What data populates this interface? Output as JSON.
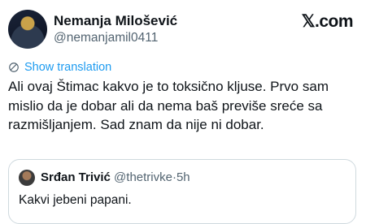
{
  "author": {
    "name": "Nemanja Milošević",
    "handle": "@nemanjamil0411"
  },
  "brand": "𝕏.com",
  "translate": {
    "label": "Show translation",
    "icon": "globe-icon"
  },
  "tweet": {
    "text": "Ali ovaj Štimac kakvo je to toksično kljuse. Prvo sam mislio da je dobar ali da nema baš previše sreće sa razmišljanjem. Sad znam da nije ni dobar."
  },
  "quoted": {
    "name": "Srđan Trivić",
    "handle": "@thetrivke",
    "separator": "·",
    "time": "5h",
    "text": "Kakvi jebeni papani."
  }
}
